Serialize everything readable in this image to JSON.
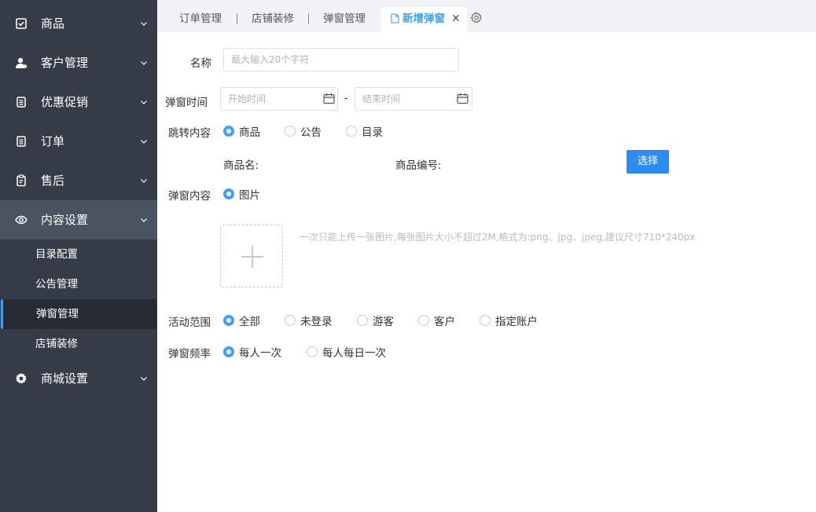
{
  "sidebar": {
    "menu": [
      {
        "label": "商品",
        "icon": "checklist-icon"
      },
      {
        "label": "客户管理",
        "icon": "user-icon"
      },
      {
        "label": "优惠促销",
        "icon": "document-icon"
      },
      {
        "label": "订单",
        "icon": "document-icon"
      },
      {
        "label": "售后",
        "icon": "clipboard-icon"
      },
      {
        "label": "内容设置",
        "icon": "eye-icon"
      },
      {
        "label": "商城设置",
        "icon": "gear-icon"
      }
    ],
    "submenu": [
      "目录配置",
      "公告管理",
      "弹窗管理",
      "店铺装修"
    ],
    "active_submenu": "弹窗管理"
  },
  "tabs": {
    "items": [
      "订单管理",
      "店铺装修",
      "弹窗管理"
    ],
    "active": "新增弹窗",
    "close_symbol": "✕"
  },
  "form": {
    "name_label": "名称",
    "name_placeholder": "最大输入20个字符",
    "time_label": "弹窗时间",
    "start_placeholder": "开始时间",
    "end_placeholder": "结束时间",
    "time_separator": "-",
    "jump_label": "跳转内容",
    "jump_options": [
      "商品",
      "公告",
      "目录"
    ],
    "product_name_label": "商品名:",
    "product_code_label": "商品编号:",
    "select_button": "选择",
    "content_label": "弹窗内容",
    "content_option": "图片",
    "upload_hint": "一次只能上传一张图片,每张图片大小不超过2M,格式为:png、jpg、jpeg,建议尺寸710*240px",
    "scope_label": "活动范围",
    "scope_options": [
      "全部",
      "未登录",
      "游客",
      "客户",
      "指定账户"
    ],
    "freq_label": "弹窗频率",
    "freq_options": [
      "每人一次",
      "每人每日一次"
    ]
  },
  "colors": {
    "sidebar_bg": "#363c47",
    "sidebar_active": "#4a5360",
    "accent": "#409eff",
    "button": "#2d8cf0"
  }
}
